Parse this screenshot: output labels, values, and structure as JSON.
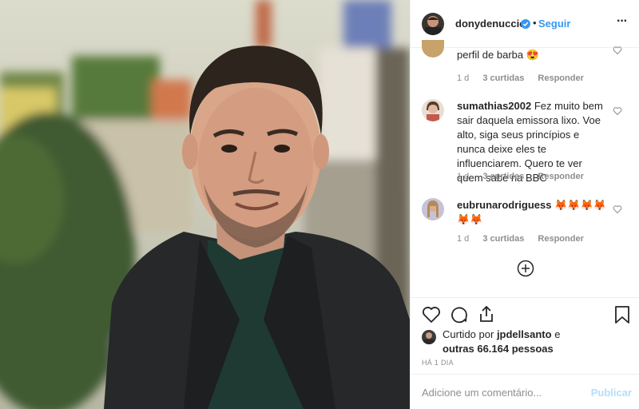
{
  "header": {
    "username": "donydenuccio",
    "follow_label": "Seguir",
    "more_label": "···"
  },
  "comments": [
    {
      "text": "perfil de barba 😍",
      "time": "1 d",
      "likes": "3 curtidas",
      "reply": "Responder"
    },
    {
      "username": "sumathias2002",
      "text": "Fez muito bem sair daquela emissora lixo. Voe alto, siga seus princípios e nunca deixe eles te influenciarem. Quero te ver quem sabe na BBC",
      "time": "1 d",
      "likes": "3 curtidas",
      "reply": "Responder"
    },
    {
      "username": "eubrunarodriguess",
      "text": "🦊🦊🦊🦊🦊🦊",
      "time": "1 d",
      "likes": "3 curtidas",
      "reply": "Responder"
    }
  ],
  "load_more_icon": "plus-circle-icon",
  "likes": {
    "prefix": "Curtido por",
    "user": "jpdellsanto",
    "middle": "e",
    "others": "outras 66.164 pessoas"
  },
  "timestamp": "HÁ 1 DIA",
  "comment_input": {
    "placeholder": "Adicione um comentário...",
    "publish_label": "Publicar"
  },
  "colors": {
    "accent": "#3897f0",
    "publish_disabled": "#b2dffc",
    "text": "#262626",
    "muted": "#8e8e8e"
  },
  "icons": [
    "verified-badge-icon",
    "heart-icon",
    "comment-icon",
    "share-icon",
    "bookmark-icon"
  ]
}
